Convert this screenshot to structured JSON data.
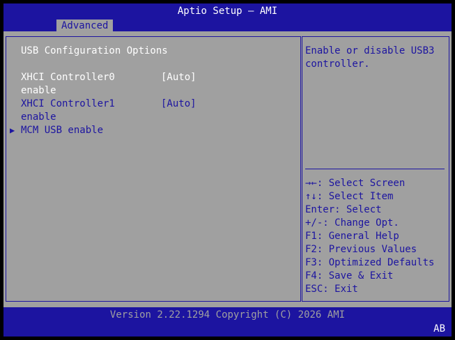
{
  "header": {
    "title": "Aptio Setup – AMI",
    "active_tab": "Advanced"
  },
  "main": {
    "section_title": "USB Configuration Options",
    "items": [
      {
        "label_line1": "XHCI Controller0",
        "label_line2": "enable",
        "value": "[Auto]"
      },
      {
        "label_line1": "XHCI Controller1",
        "label_line2": "enable",
        "value": "[Auto]"
      }
    ],
    "submenu": {
      "arrow": "▶",
      "label": "MCM USB enable"
    }
  },
  "help": {
    "description_line1": "Enable or disable USB3",
    "description_line2": "controller.",
    "keys": [
      "→←: Select Screen",
      "↑↓: Select Item",
      "Enter: Select",
      "+/-: Change Opt.",
      "F1: General Help",
      "F2: Previous Values",
      "F3: Optimized Defaults",
      "F4: Save & Exit",
      "ESC: Exit"
    ]
  },
  "footer": {
    "version": "Version 2.22.1294 Copyright (C) 2026 AMI",
    "mode": "AB"
  },
  "colors": {
    "bar_blue": "#1c14a0",
    "panel_gray": "#a0a0a0",
    "text_white": "#ffffff"
  }
}
